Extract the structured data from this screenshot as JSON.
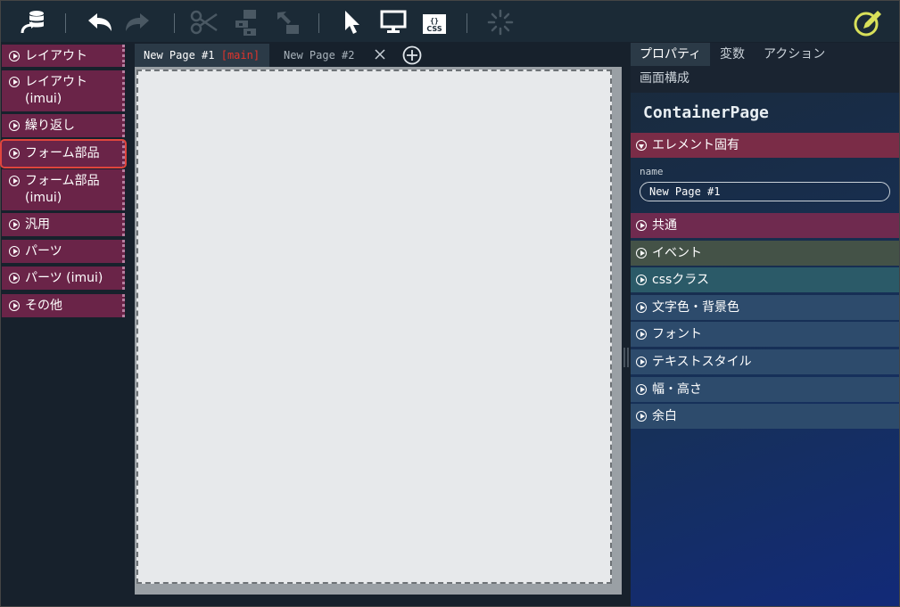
{
  "toolbar": {
    "icons": [
      "database-flow-icon",
      "undo-icon",
      "redo-icon",
      "cut-icon",
      "sitemap-icon",
      "move-icon",
      "cursor-icon",
      "monitor-icon",
      "css-icon",
      "spinner-icon",
      "edit-icon"
    ],
    "css_icon_text": "CSS",
    "css_icon_braces": "{}"
  },
  "palette": {
    "items": [
      {
        "label": "レイアウト"
      },
      {
        "label": "レイアウト",
        "sub": "(imui)"
      },
      {
        "label": "繰り返し"
      },
      {
        "label": "フォーム部品",
        "selected": true
      },
      {
        "label": "フォーム部品",
        "sub": "(imui)"
      },
      {
        "label": "汎用"
      },
      {
        "label": "パーツ"
      },
      {
        "label": "パーツ (imui)"
      },
      {
        "label": "その他"
      }
    ]
  },
  "tabs": {
    "active_label": "New Page #1",
    "active_branch": "[main]",
    "inactive_label": "New Page #2"
  },
  "right": {
    "tabs": [
      "プロパティ",
      "変数",
      "アクション",
      "画面構成"
    ],
    "title": "ContainerPage",
    "sections": [
      {
        "label": "エレメント固有",
        "color": "#7a2c47",
        "expanded": true
      },
      {
        "label": "共通",
        "color": "#6f2a4f"
      },
      {
        "label": "イベント",
        "color": "#445247"
      },
      {
        "label": "cssクラス",
        "color": "#2b5a68"
      },
      {
        "label": "文字色・背景色",
        "color": "#2d4b6c"
      },
      {
        "label": "フォント",
        "color": "#2d4b6c"
      },
      {
        "label": "テキストスタイル",
        "color": "#2d4b6c"
      },
      {
        "label": "幅・高さ",
        "color": "#2d4b6c"
      },
      {
        "label": "余白",
        "color": "#2d4b6c"
      }
    ],
    "name_label": "name",
    "name_value": "New Page #1"
  },
  "colors": {
    "palette_bg": "#6a2448",
    "selected_outline": "#e0453d",
    "branch_red": "#e2342b",
    "edit_icon": "#d8e05a"
  }
}
